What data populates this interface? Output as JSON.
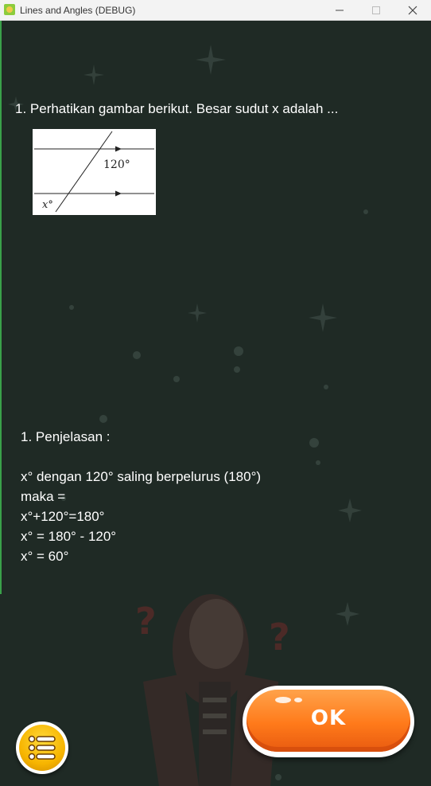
{
  "window": {
    "title": "Lines and Angles (DEBUG)",
    "controls": {
      "minimize": "—",
      "close": "✕"
    }
  },
  "question": {
    "text": "1. Perhatikan gambar berikut. Besar sudut x adalah ...",
    "figure": {
      "angle_label": "120°",
      "x_label": "x°"
    }
  },
  "explanation": {
    "heading": "1. Penjelasan :",
    "lines": [
      "x° dengan 120° saling berpelurus (180°)",
      "maka =",
      "x°+120°=180°",
      "x° = 180° - 120°",
      "x° = 60°"
    ]
  },
  "buttons": {
    "ok_label": "OK",
    "menu_icon": "list-menu-icon"
  },
  "colors": {
    "background": "#1f2a25",
    "ok_orange": "#ff7a1a",
    "menu_yellow": "#f7b500"
  }
}
